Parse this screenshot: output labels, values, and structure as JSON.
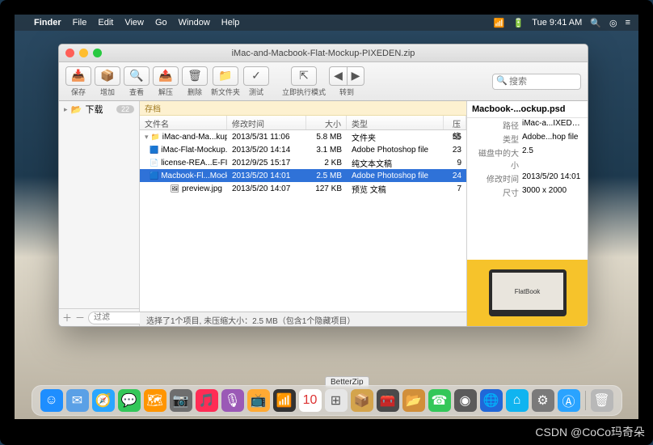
{
  "menubar": {
    "app": "Finder",
    "items": [
      "File",
      "Edit",
      "View",
      "Go",
      "Window",
      "Help"
    ],
    "right": {
      "wifi": "📶",
      "battery": "🔋",
      "clock": "Tue 9:41 AM",
      "search": "🔍",
      "siri": "◎",
      "list": "≡"
    }
  },
  "window": {
    "title": "iMac-and-Macbook-Flat-Mockup-PIXEDEN.zip",
    "toolbar": [
      {
        "icon": "📥",
        "label": "保存"
      },
      {
        "icon": "📦",
        "label": "增加"
      },
      {
        "icon": "🔍",
        "label": "查看"
      },
      {
        "icon": "📤",
        "label": "解压"
      },
      {
        "icon": "🗑",
        "label": "删除"
      },
      {
        "icon": "📁",
        "label": "新文件夹"
      },
      {
        "icon": "✓",
        "label": "测试"
      }
    ],
    "toolbar2": [
      {
        "icon": "⇱",
        "label": "立即执行模式"
      }
    ],
    "nav_label": "转到",
    "search_placeholder": "搜索"
  },
  "sidebar": {
    "item": {
      "icon": "📂",
      "label": "下载",
      "badge": "22"
    },
    "filter_placeholder": "过滤"
  },
  "columns": {
    "name": "文件名",
    "date": "修改时间",
    "size": "大小",
    "type": "类型",
    "comp": "压缩"
  },
  "notice": "存档",
  "rows": [
    {
      "indent": 0,
      "folder": true,
      "expanded": true,
      "icon": "📁",
      "name": "iMac-and-Ma...kup-PIXEDEN",
      "date": "2013/5/31 11:06",
      "size": "5.8 MB",
      "type": "文件夹",
      "comp": "55"
    },
    {
      "indent": 1,
      "icon": "🟦",
      "name": "iMac-Flat-Mockup.psd",
      "date": "2013/5/20 14:14",
      "size": "3.1 MB",
      "type": "Adobe Photoshop file",
      "comp": "23"
    },
    {
      "indent": 1,
      "icon": "📄",
      "name": "license-REA...E-FIRST.txt",
      "date": "2012/9/25 15:17",
      "size": "2 KB",
      "type": "纯文本文稿",
      "comp": "9"
    },
    {
      "indent": 1,
      "selected": true,
      "icon": "🟦",
      "name": "Macbook-Fl...Mockup.psd",
      "date": "2013/5/20 14:01",
      "size": "2.5 MB",
      "type": "Adobe Photoshop file",
      "comp": "24"
    },
    {
      "indent": 1,
      "icon": "🖼",
      "name": "preview.jpg",
      "date": "2013/5/20 14:07",
      "size": "127 KB",
      "type": "预览 文稿",
      "comp": "7"
    }
  ],
  "status": "选择了1个项目, 未压缩大小：2.5 MB（包含1个隐藏项目）",
  "inspector": {
    "title": "Macbook-...ockup.psd",
    "rows": [
      {
        "k": "路径",
        "v": "iMac-a...IXEDEN"
      },
      {
        "k": "类型",
        "v": "Adobe...hop file"
      },
      {
        "k": "磁盘中的大小",
        "v": "2.5"
      },
      {
        "k": "修改时间",
        "v": "2013/5/20 14:01"
      },
      {
        "k": "尺寸",
        "v": "3000 x 2000"
      }
    ],
    "preview_label": "FlatBook"
  },
  "dock": {
    "tooltip": "BetterZip",
    "apps": [
      {
        "c": "#1e8eff",
        "t": "☺"
      },
      {
        "c": "#5aa0e6",
        "t": "✉"
      },
      {
        "c": "#2aa6ff",
        "t": "🧭"
      },
      {
        "c": "#34c759",
        "t": "💬"
      },
      {
        "c": "#ff9500",
        "t": "🗺"
      },
      {
        "c": "#6e6e6e",
        "t": "📷"
      },
      {
        "c": "#ff2d55",
        "t": "🎵"
      },
      {
        "c": "#9b59b6",
        "t": "🎙"
      },
      {
        "c": "#ffaa33",
        "t": "📺"
      },
      {
        "c": "#333",
        "t": "📶"
      },
      {
        "c": "#fff",
        "t": "10",
        "fg": "#d33"
      },
      {
        "c": "#e6e6e6",
        "t": "⊞",
        "fg": "#555"
      },
      {
        "c": "#d4a44c",
        "t": "📦"
      },
      {
        "c": "#4a4a4a",
        "t": "🧰"
      },
      {
        "c": "#d18f3a",
        "t": "📂"
      },
      {
        "c": "#34c759",
        "t": "☎"
      },
      {
        "c": "#5b5b5b",
        "t": "◉"
      },
      {
        "c": "#2067d8",
        "t": "🌐"
      },
      {
        "c": "#0fb4f0",
        "t": "⌂"
      },
      {
        "c": "#7a7a7a",
        "t": "⚙"
      },
      {
        "c": "#2aa3ff",
        "t": "Ⓐ"
      }
    ],
    "trash": "🗑"
  },
  "watermark": "CSDN @CoCo玛奇朵"
}
